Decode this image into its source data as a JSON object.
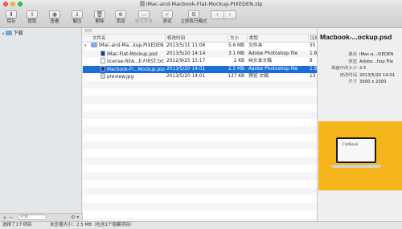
{
  "window": {
    "title": "iMac-and-Macbook-Flat-Mockup-PIXEDEN.zip"
  },
  "toolbar": {
    "items": [
      {
        "label": "保存",
        "icon": "save-icon",
        "glyph": "⬇",
        "enabled": true
      },
      {
        "label": "提取",
        "icon": "extract-icon",
        "glyph": "⇪",
        "enabled": true
      },
      {
        "label": "查看",
        "icon": "view-icon",
        "glyph": "◉",
        "enabled": true
      },
      {
        "label": "解压",
        "icon": "unarchive-icon",
        "glyph": "⇓",
        "enabled": true
      },
      {
        "label": "删除",
        "icon": "trash-icon",
        "glyph": "🗑",
        "enabled": true
      },
      {
        "label": "添加",
        "icon": "add-icon",
        "glyph": "⊕",
        "enabled": true
      },
      {
        "label": "新文件夹",
        "icon": "new-folder-icon",
        "glyph": "▭",
        "enabled": false
      },
      {
        "label": "测试",
        "icon": "test-icon",
        "glyph": "✓",
        "enabled": true
      },
      {
        "label": "立即执行模式",
        "icon": "immediate-mode-icon",
        "glyph": "⚙",
        "enabled": true
      }
    ],
    "nav_back": "‹",
    "nav_forward": "›"
  },
  "sidebar": {
    "items": [
      {
        "label": "下载",
        "disclosure": "▸"
      }
    ],
    "add_button": "+",
    "remove_button": "−",
    "search_placeholder": "搜索",
    "gear": "⚙ ▾"
  },
  "filelist": {
    "path_label": "目的",
    "columns": {
      "name": "文件名",
      "modified": "修改时间",
      "size": "大小",
      "kind": "类型",
      "compressed": "压缩"
    },
    "rows": [
      {
        "disc": "▾",
        "name": "iMac-and-Ma...kup-PIXEDEN",
        "modified": "2013/5/31 11:06",
        "size": "5.6 MB",
        "kind": "文件夹",
        "compressed": "55",
        "icon": "folder",
        "indent": 0,
        "selected": false
      },
      {
        "disc": "",
        "name": "iMac-Flat-Mockup.psd",
        "modified": "2013/5/20 14:14",
        "size": "3.1 MB",
        "kind": "Adobe Photoshop file",
        "compressed": "1.8",
        "icon": "psd",
        "indent": 1,
        "selected": false
      },
      {
        "disc": "",
        "name": "license-REA...E-FIRST.txt",
        "modified": "2012/9/25 15:17",
        "size": "2 KB",
        "kind": "纯文本文稿",
        "compressed": "8",
        "icon": "txt",
        "indent": 1,
        "selected": false
      },
      {
        "disc": "",
        "name": "Macbook-Fl...Mockup.psd",
        "modified": "2013/5/20 14:01",
        "size": "2.5 MB",
        "kind": "Adobe Photoshop file",
        "compressed": "1.9",
        "icon": "psd",
        "indent": 1,
        "selected": true
      },
      {
        "disc": "",
        "name": "preview.jpg",
        "modified": "2013/5/20 14:01",
        "size": "137 KB",
        "kind": "预览 文稿",
        "compressed": "13",
        "icon": "jpg",
        "indent": 1,
        "selected": false
      }
    ]
  },
  "inspector": {
    "title": "Macbook-...ockup.psd",
    "fields": [
      {
        "key": "路径",
        "value": "iMac-a...IXEDEN"
      },
      {
        "key": "类型",
        "value": "Adobe...hop File"
      },
      {
        "key": "磁盘中的大小",
        "value": "2.5"
      },
      {
        "key": "修改时间",
        "value": "2013/5/20 14:01"
      },
      {
        "key": "尺寸",
        "value": "3000 x 2000"
      }
    ],
    "preview_text": "FlatBook",
    "preview_color": "#f5b51c"
  },
  "status": {
    "selection": "选择了1个项目",
    "uncompressed": "未压缩大小：2.5 MB（包含1个隐藏项目）"
  }
}
